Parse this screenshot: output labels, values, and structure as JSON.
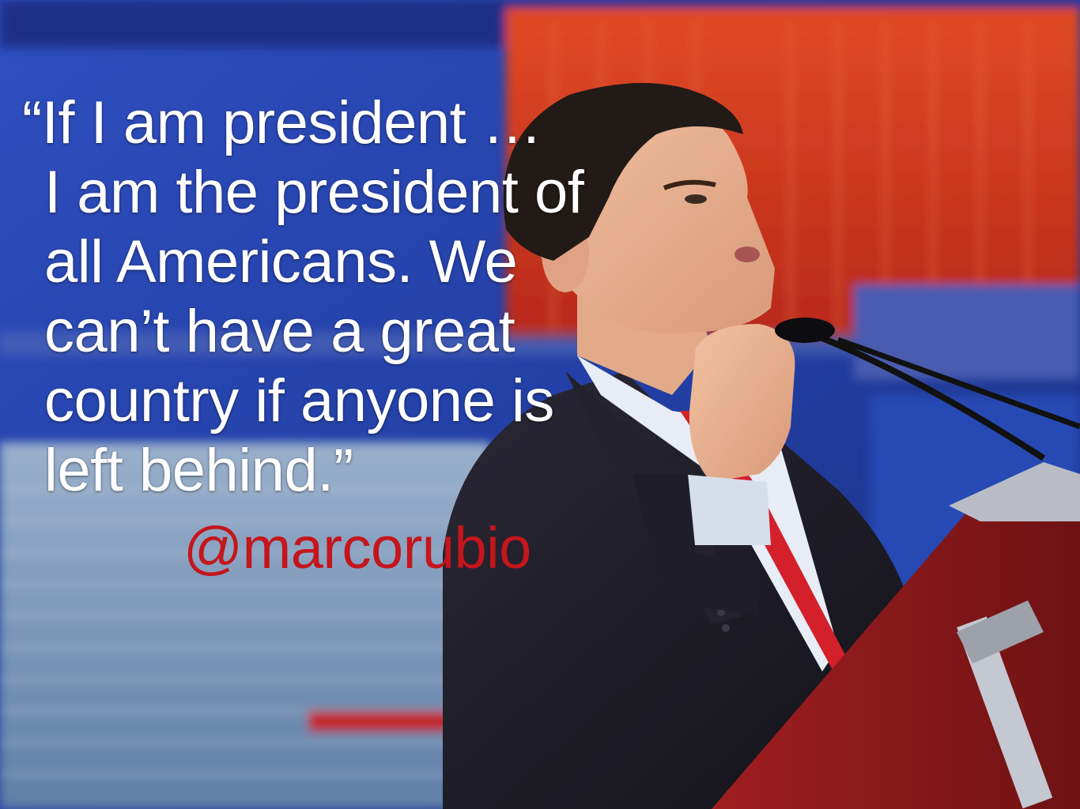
{
  "quote": {
    "lines": [
      "“If I am president …",
      "I am the president of",
      "all Americans. We",
      "can’t have a great",
      "country if anyone is",
      "left behind.”"
    ]
  },
  "attribution": {
    "handle": "@marcorubio"
  },
  "colors": {
    "quote_text": "#ffffff",
    "handle_text": "#c4161c",
    "backdrop_blue": "#1f3a9c",
    "backdrop_red": "#d2341c",
    "suit": "#1b1a22",
    "tie": "#d3202a",
    "podium": "#8e1a1c"
  }
}
